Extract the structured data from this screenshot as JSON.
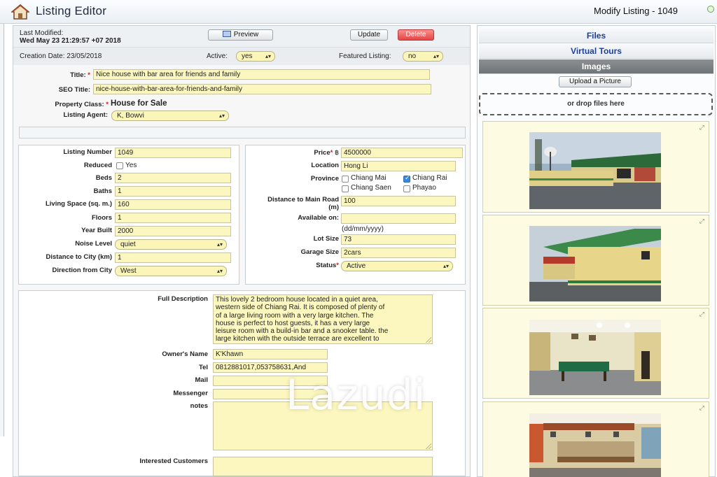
{
  "app": {
    "title": "Listing Editor",
    "modify_title": "Modify Listing - 1049"
  },
  "header": {
    "last_modified_label": "Last Modified:",
    "last_modified_value": "Wed May 23 21:29:57 +07 2018",
    "creation_date": "Creation Date: 23/05/2018",
    "preview_label": "Preview",
    "update_label": "Update",
    "delete_label": "Delete",
    "active_label": "Active:",
    "active_value": "yes",
    "featured_label": "Featured Listing:",
    "featured_value": "no"
  },
  "basic": {
    "title_label": "Title:",
    "title_value": "Nice house with bar area for friends and family",
    "seo_label": "SEO Title:",
    "seo_value": "nice-house-with-bar-area-for-friends-and-family",
    "class_label": "Property Class:",
    "class_value": "House for Sale",
    "agent_label": "Listing Agent:",
    "agent_value": "K, Bowvi"
  },
  "left_fields": {
    "listing_number_label": "Listing Number",
    "listing_number_value": "1049",
    "reduced_label": "Reduced",
    "reduced_option": "Yes",
    "beds_label": "Beds",
    "beds_value": "2",
    "baths_label": "Baths",
    "baths_value": "1",
    "living_label": "Living Space (sq. m.)",
    "living_value": "160",
    "floors_label": "Floors",
    "floors_value": "1",
    "year_label": "Year Built",
    "year_value": "2000",
    "noise_label": "Noise Level",
    "noise_value": "quiet",
    "dist_city_label": "Distance to City (km)",
    "dist_city_value": "1",
    "direction_label": "Direction from City",
    "direction_value": "West"
  },
  "right_fields": {
    "price_label": "Price",
    "currency": "฿",
    "price_value": "4500000",
    "location_label": "Location",
    "location_value": "Hong Li",
    "province_label": "Province",
    "provinces": [
      {
        "name": "Chiang Mai",
        "checked": false
      },
      {
        "name": "Chiang Rai",
        "checked": true
      },
      {
        "name": "Chiang Saen",
        "checked": false
      },
      {
        "name": "Phayao",
        "checked": false
      }
    ],
    "dist_road_label_1": "Distance to Main Road",
    "dist_road_label_2": "(m)",
    "dist_road_value": "100",
    "available_label": "Available on:",
    "available_value": "",
    "date_format": "(dd/mm/yyyy)",
    "lot_label": "Lot Size",
    "lot_value": "73",
    "garage_label": "Garage Size",
    "garage_value": "2cars",
    "status_label": "Status",
    "status_value": "Active"
  },
  "description": {
    "full_label": "Full Description",
    "lines": [
      "This lovely 2 bedroom house located in a quiet area,",
      "western side of  Chiang Rai. It is composed of plenty of",
      "of a large living room with a very large kitchen. The",
      "house is perfect to host guests, it has a very large",
      "leisure room with a build-in bar and a snooker table. the",
      "large kitchen with the outside terrace are excellent to"
    ],
    "owner_label": "Owner's Name",
    "owner_value": "K'Khawn",
    "tel_label": "Tel",
    "tel_value": "0812881017,053758631,And",
    "mail_label": "Mail",
    "mail_value": "",
    "messenger_label": "Messenger",
    "messenger_value": "",
    "notes_label": "notes",
    "notes_value": "",
    "interested_label": "Interested Customers",
    "interested_value": ""
  },
  "sidebar": {
    "files_label": "Files",
    "tours_label": "Virtual Tours",
    "images_label": "Images",
    "upload_label": "Upload a Picture",
    "drop_label": "or drop files here",
    "expand_glyph": "⤢"
  },
  "watermark": "Lazudi"
}
